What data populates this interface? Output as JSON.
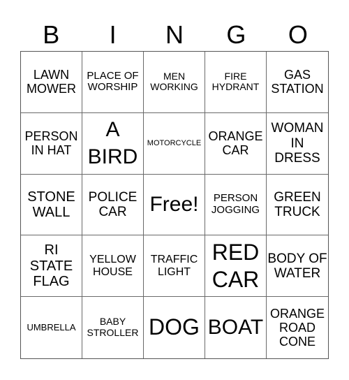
{
  "header": {
    "letters": [
      "B",
      "I",
      "N",
      "G",
      "O"
    ]
  },
  "card": {
    "rows": [
      [
        "LAWN MOWER",
        "PLACE OF WORSHIP",
        "MEN WORKING",
        "FIRE HYDRANT",
        "GAS STATION"
      ],
      [
        "PERSON IN HAT",
        "A BIRD",
        "MOTORCYCLE",
        "ORANGE CAR",
        "WOMAN IN DRESS"
      ],
      [
        "STONE WALL",
        "POLICE CAR",
        "Free!",
        "PERSON JOGGING",
        "GREEN TRUCK"
      ],
      [
        "RI STATE FLAG",
        "YELLOW HOUSE",
        "TRAFFIC LIGHT",
        "RED CAR",
        "BODY OF WATER"
      ],
      [
        "UMBRELLA",
        "BABY STROLLER",
        "DOG",
        "BOAT",
        "ORANGE ROAD CONE"
      ]
    ]
  }
}
